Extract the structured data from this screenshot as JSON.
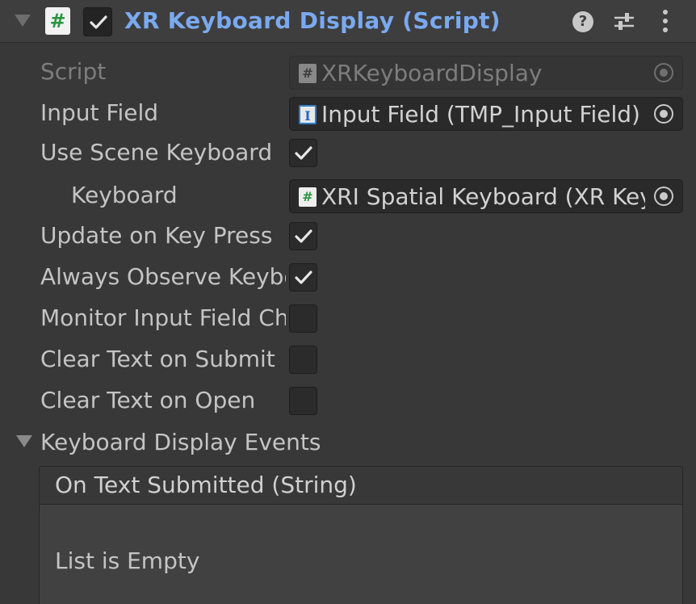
{
  "header": {
    "title": "XR Keyboard Display (Script)",
    "component_icon": "script-hash-icon",
    "enabled": true,
    "help_glyph": "?",
    "accent_color": "#7aa9ef"
  },
  "fields": {
    "script": {
      "label": "Script",
      "value": "XRKeyboardDisplay",
      "icon": "script-hash-icon"
    },
    "input_field": {
      "label": "Input Field",
      "value": "Input Field (TMP_Input Field)",
      "icon": "text-cursor-icon",
      "icon_glyph": "I"
    },
    "use_scene_keyboard": {
      "label": "Use Scene Keyboard",
      "checked": true
    },
    "keyboard": {
      "label": "Keyboard",
      "value": "XRI Spatial Keyboard (XR Keyboard)",
      "icon": "script-hash-icon"
    },
    "update_on_key_press": {
      "label": "Update on Key Press",
      "checked": true
    },
    "always_observe_keyboard": {
      "label": "Always Observe Keyboard",
      "checked": true
    },
    "monitor_input_field_changes": {
      "label": "Monitor Input Field Changes",
      "checked": false
    },
    "clear_text_on_submit": {
      "label": "Clear Text on Submit",
      "checked": false
    },
    "clear_text_on_open": {
      "label": "Clear Text on Open",
      "checked": false
    }
  },
  "events": {
    "section_label": "Keyboard Display Events",
    "on_text_submitted": {
      "title": "On Text Submitted (String)",
      "empty_text": "List is Empty"
    }
  }
}
